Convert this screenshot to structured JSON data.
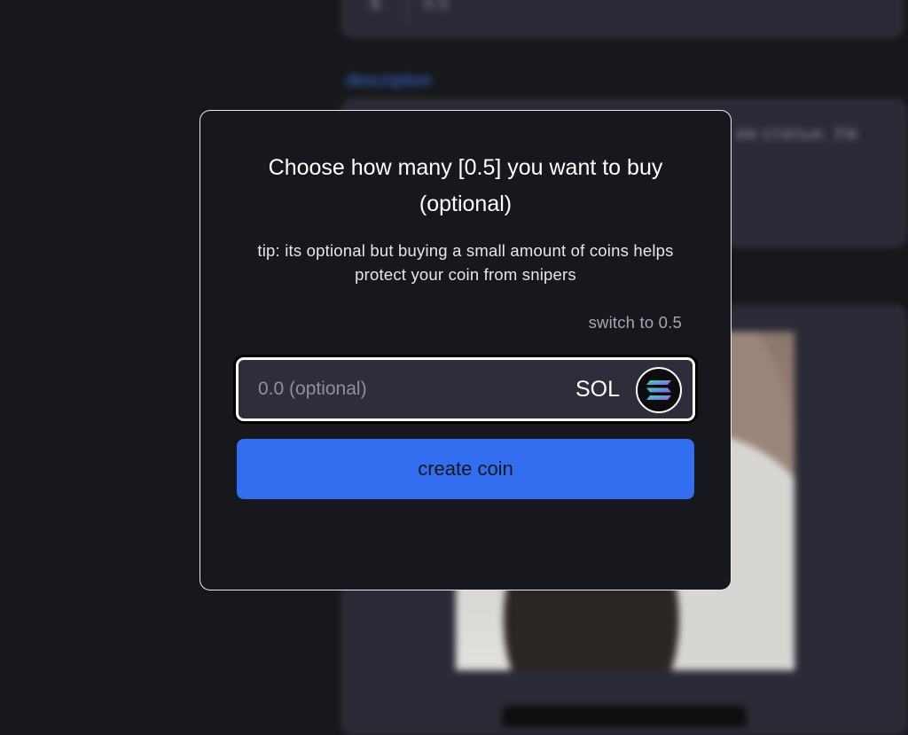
{
  "background": {
    "ticker_prefix": "$",
    "ticker_value": "0.5",
    "description_label": "description",
    "description_text": "ии статьи. Уж"
  },
  "modal": {
    "title": "Choose how many [0.5] you want to buy (optional)",
    "tip": "tip: its optional but buying a small amount of coins helps protect your coin from snipers",
    "switch_label": "switch to 0.5",
    "amount_field": {
      "value": "",
      "placeholder": "0.0 (optional)",
      "currency": "SOL",
      "currency_icon": "solana-logo-icon"
    },
    "submit_label": "create coin"
  },
  "colors": {
    "accent": "#336ef0",
    "modal_bg": "#17181d",
    "input_bg": "#2d2e3a"
  }
}
